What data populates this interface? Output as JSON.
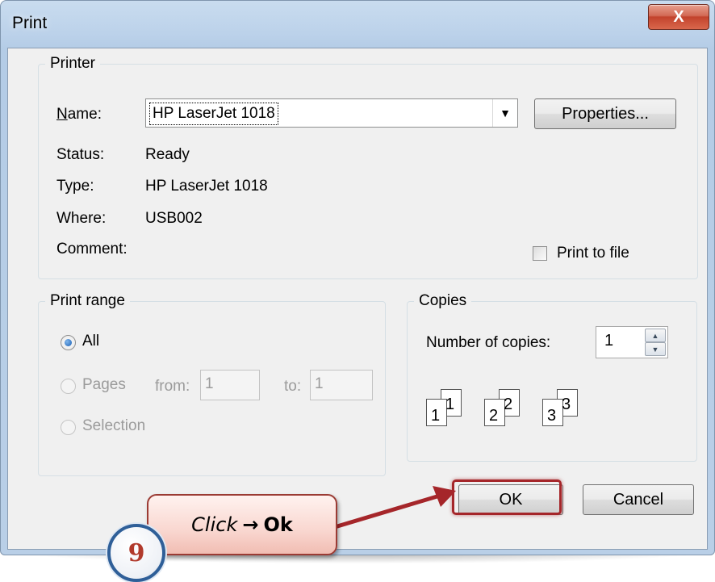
{
  "dialog": {
    "title": "Print",
    "close_glyph": "X"
  },
  "printer": {
    "legend": "Printer",
    "name_label": "Name:",
    "name_value": "HP LaserJet 1018",
    "properties_label": "Properties...",
    "status_label": "Status:",
    "status_value": "Ready",
    "type_label": "Type:",
    "type_value": "HP LaserJet 1018",
    "where_label": "Where:",
    "where_value": "USB002",
    "comment_label": "Comment:",
    "comment_value": "",
    "print_to_file_label": "Print to file",
    "print_to_file_checked": false
  },
  "print_range": {
    "legend": "Print range",
    "all_label": "All",
    "pages_label": "Pages",
    "from_label": "from:",
    "from_value": "1",
    "to_label": "to:",
    "to_value": "1",
    "selection_label": "Selection",
    "selected": "All"
  },
  "copies": {
    "legend": "Copies",
    "number_label": "Number of copies:",
    "number_value": "1",
    "collate_numbers": [
      "1",
      "1",
      "2",
      "2",
      "3",
      "3"
    ]
  },
  "buttons": {
    "ok_label": "OK",
    "cancel_label": "Cancel"
  },
  "annotation": {
    "callout_click": "Click",
    "callout_arrow": "→",
    "callout_target": "Ok",
    "step_number": "9",
    "highlight_color": "#a5262a"
  }
}
